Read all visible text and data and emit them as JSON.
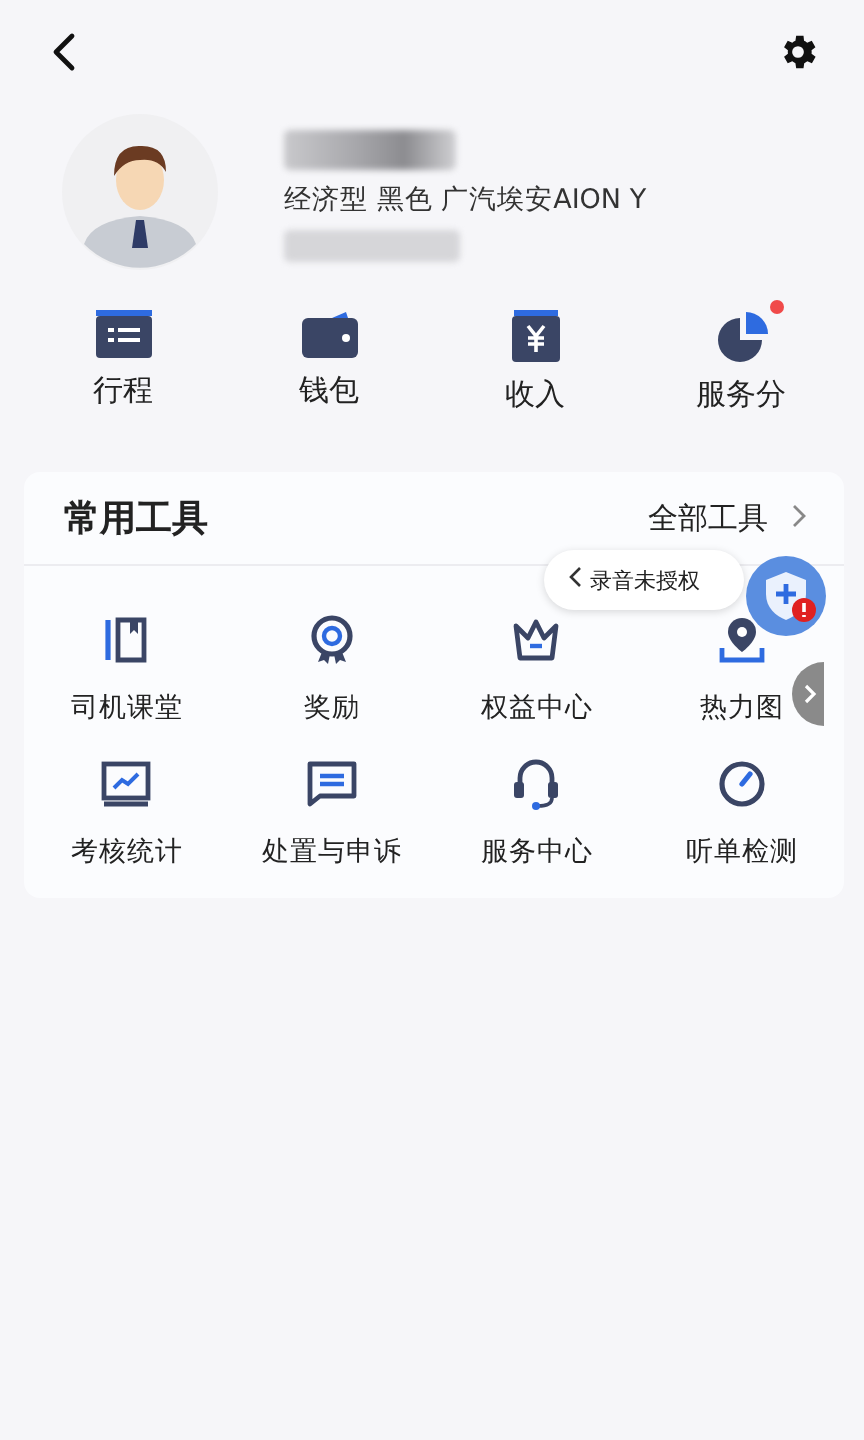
{
  "profile": {
    "vehicle": "经济型 黑色 广汽埃安AION Y"
  },
  "quick_entries": [
    {
      "label": "行程",
      "badge": false
    },
    {
      "label": "钱包",
      "badge": false
    },
    {
      "label": "收入",
      "badge": false
    },
    {
      "label": "服务分",
      "badge": true
    }
  ],
  "tools": {
    "title": "常用工具",
    "all_link": "全部工具",
    "items": [
      {
        "label": "司机课堂"
      },
      {
        "label": "奖励"
      },
      {
        "label": "权益中心"
      },
      {
        "label": "热力图"
      },
      {
        "label": "考核统计"
      },
      {
        "label": "处置与申诉"
      },
      {
        "label": "服务中心"
      },
      {
        "label": "听单检测"
      }
    ]
  },
  "recording_notice": {
    "text": "录音未授权"
  }
}
